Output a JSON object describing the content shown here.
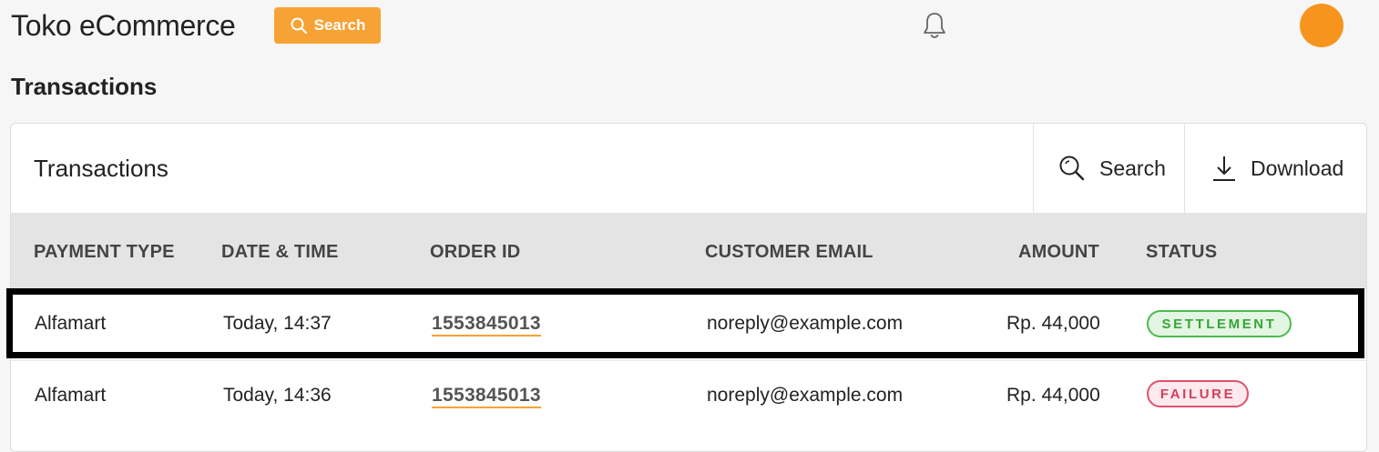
{
  "app": {
    "title": "Toko eCommerce",
    "search_label": "Search"
  },
  "page": {
    "heading": "Transactions"
  },
  "card": {
    "title": "Transactions",
    "search_label": "Search",
    "download_label": "Download"
  },
  "table": {
    "headers": [
      "PAYMENT TYPE",
      "DATE & TIME",
      "ORDER ID",
      "CUSTOMER EMAIL",
      "AMOUNT",
      "STATUS"
    ],
    "rows": [
      {
        "payment_type": "Alfamart",
        "datetime": "Today, 14:37",
        "order_id": "1553845013",
        "email": "noreply@example.com",
        "amount": "Rp. 44,000",
        "status": "SETTLEMENT"
      },
      {
        "payment_type": "Alfamart",
        "datetime": "Today, 14:36",
        "order_id": "1553845013",
        "email": "noreply@example.com",
        "amount": "Rp. 44,000",
        "status": "FAILURE"
      }
    ]
  },
  "colors": {
    "accent": "#f7a234",
    "avatar": "#f7941d",
    "settlement": "#37a537",
    "failure": "#d2405b"
  },
  "icons": {
    "top_search": "search-icon",
    "notifications": "bell-icon",
    "card_search": "search-icon",
    "download": "download-icon"
  }
}
